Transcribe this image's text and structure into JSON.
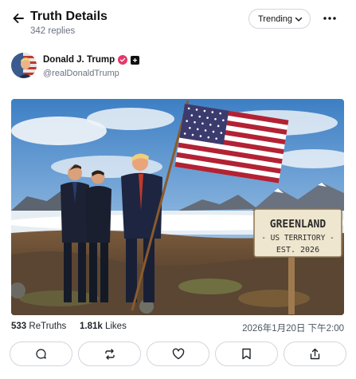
{
  "header": {
    "title": "Truth Details",
    "replies": "342 replies",
    "sort_label": "Trending"
  },
  "author": {
    "name": "Donald J. Trump",
    "handle": "@realDonaldTrump"
  },
  "media": {
    "sign_line1": "GREENLAND",
    "sign_line2": "- US TERRITORY -",
    "sign_line3": "EST. 2026"
  },
  "stats": {
    "retruths_count": "533",
    "retruths_label": "ReTruths",
    "likes_count": "1.81k",
    "likes_label": "Likes",
    "timestamp": "2026年1月20日 下午2:00"
  },
  "actions": [
    "reply-icon",
    "retruth-icon",
    "like-icon",
    "bookmark-icon",
    "share-icon"
  ],
  "colors": {
    "verified": "#e2396b",
    "border": "#d1d5db",
    "muted": "#6b7280"
  }
}
